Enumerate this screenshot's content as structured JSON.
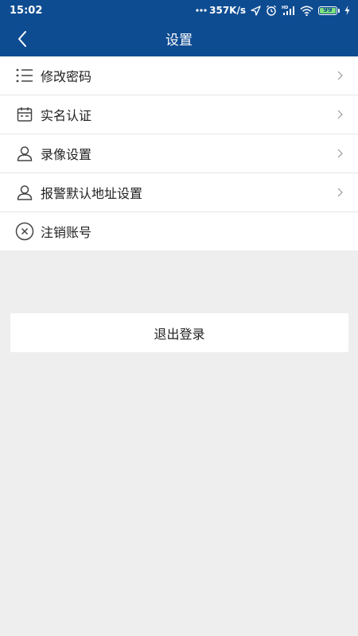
{
  "status_bar": {
    "time": "15:02",
    "net_speed": "357K/s",
    "battery_level": "99",
    "icons": [
      "more-dots-icon",
      "location-arrow-icon",
      "alarm-icon",
      "signal-hd-icon",
      "wifi-icon",
      "battery-icon",
      "charging-icon"
    ]
  },
  "app_bar": {
    "title": "设置",
    "back_icon": "chevron-left-icon"
  },
  "menu": {
    "items": [
      {
        "label": "修改密码",
        "icon": "list-icon",
        "has_chevron": true
      },
      {
        "label": "实名认证",
        "icon": "calendar-icon",
        "has_chevron": true
      },
      {
        "label": "录像设置",
        "icon": "user-icon",
        "has_chevron": true
      },
      {
        "label": "报警默认地址设置",
        "icon": "user-icon",
        "has_chevron": true
      },
      {
        "label": "注销账号",
        "icon": "close-circle-icon",
        "has_chevron": false
      }
    ]
  },
  "logout": {
    "label": "退出登录"
  },
  "colors": {
    "primary": "#0e4c92",
    "background": "#eeeeee",
    "card": "#ffffff",
    "text": "#222222",
    "divider": "#e6e6e6"
  }
}
